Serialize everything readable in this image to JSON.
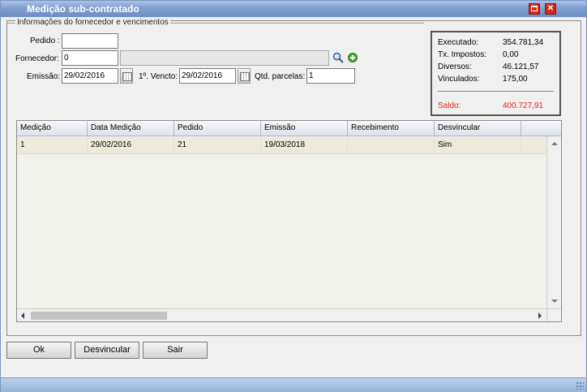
{
  "window": {
    "title": "Medição sub-contratado"
  },
  "section": {
    "legend": "Informações do fornecedor e vencimentos"
  },
  "form": {
    "pedido_label": "Pedido :",
    "pedido_value": "",
    "fornecedor_label": "Fornecedor:",
    "fornecedor_code": "0",
    "fornecedor_name": "",
    "emissao_label": "Emissão:",
    "emissao_value": "29/02/2016",
    "vencto_label": "1º. Vencto:",
    "vencto_value": "29/02/2016",
    "parcelas_label": "Qtd. parcelas:",
    "parcelas_value": "1"
  },
  "summary": {
    "executado_label": "Executado:",
    "executado_value": "354.781,34",
    "impostos_label": "Tx. Impostos:",
    "impostos_value": "0,00",
    "diversos_label": "Diversos:",
    "diversos_value": "46.121,57",
    "vinculados_label": "Vinculados:",
    "vinculados_value": "175,00",
    "saldo_label": "Saldo:",
    "saldo_value": "400.727,91",
    "saldo_color": "#e0261a"
  },
  "table": {
    "columns": [
      "Medição",
      "Data Medição",
      "Pedido",
      "Emissão",
      "Recebimento",
      "Desvincular"
    ],
    "rows": [
      [
        "1",
        "29/02/2016",
        "21",
        "19/03/2018",
        "",
        "Sim"
      ]
    ]
  },
  "buttons": {
    "ok": "Ok",
    "desvincular": "Desvincular",
    "sair": "Sair"
  },
  "icons": {
    "search": "search-icon",
    "add": "add-icon",
    "calendar": "calendar-icon"
  }
}
